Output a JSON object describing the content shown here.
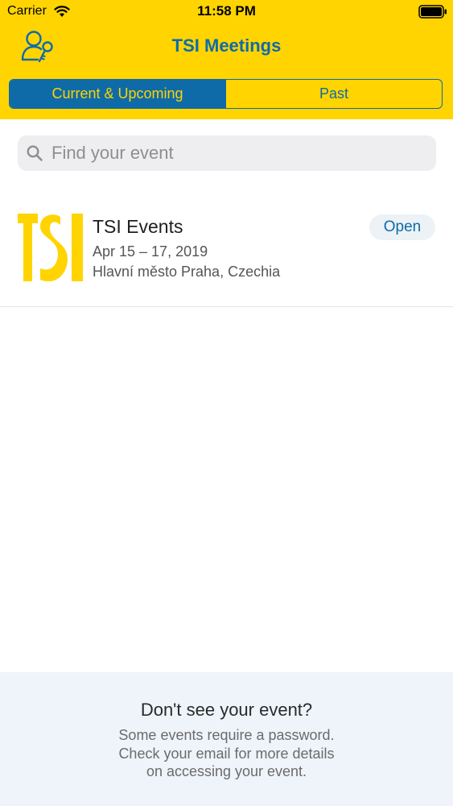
{
  "status_bar": {
    "carrier": "Carrier",
    "time": "11:58 PM"
  },
  "header": {
    "title": "TSI Meetings",
    "background_color": "#FFD400",
    "accent_color": "#0E6BA8",
    "login_icon": "user-key-icon"
  },
  "tabs": [
    {
      "label": "Current & Upcoming",
      "selected": true
    },
    {
      "label": "Past",
      "selected": false
    }
  ],
  "search": {
    "placeholder": "Find your event",
    "value": ""
  },
  "events": [
    {
      "logo_text": "TSI",
      "name": "TSI Events",
      "dates": "Apr 15 – 17, 2019",
      "location": "Hlavní město Praha, Czechia",
      "action_label": "Open"
    }
  ],
  "footer": {
    "title": "Don't see your event?",
    "lines": [
      "Some events require a password.",
      "Check your email for more details",
      "on accessing your event."
    ]
  }
}
